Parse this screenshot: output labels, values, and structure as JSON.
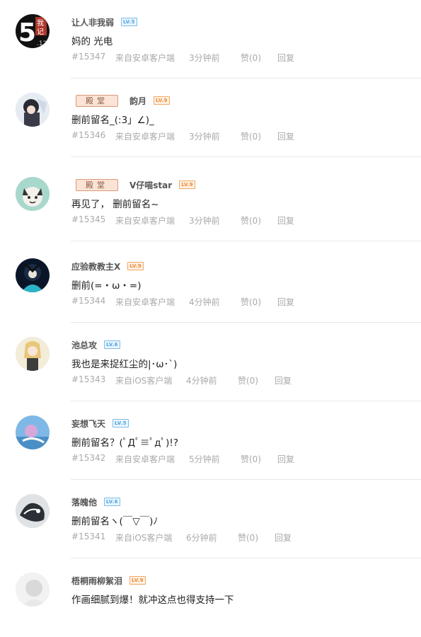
{
  "comments": [
    {
      "username": "让人非我弱",
      "level": "LV.5",
      "level_color": "#4aa3e0",
      "medal": "",
      "content": "妈的 光电",
      "number": "#15347",
      "source": "来自安卓客户端",
      "time": "3分钟前",
      "like": "赞(0)",
      "reply": "回复"
    },
    {
      "username": "韵月",
      "level": "LV.9",
      "level_color": "#f08a2e",
      "medal": "殿堂",
      "content": "删前留名_(:3」∠)_",
      "number": "#15346",
      "source": "来自安卓客户端",
      "time": "3分钟前",
      "like": "赞(0)",
      "reply": "回复"
    },
    {
      "username": "V仔喵star",
      "level": "LV.9",
      "level_color": "#f08a2e",
      "medal": "殿堂",
      "content": "再见了， 删前留名~",
      "number": "#15345",
      "source": "来自安卓客户端",
      "time": "3分钟前",
      "like": "赞(0)",
      "reply": "回复"
    },
    {
      "username": "应验教教主X",
      "level": "LV.9",
      "level_color": "#f08a2e",
      "medal": "",
      "content": "删前(=・ω・=)",
      "number": "#15344",
      "source": "来自安卓客户端",
      "time": "4分钟前",
      "like": "赞(0)",
      "reply": "回复"
    },
    {
      "username": "池总攻",
      "level": "LV.6",
      "level_color": "#4aa3e0",
      "medal": "",
      "content": "我也是来捉红尘的|･ω･`)",
      "number": "#15343",
      "source": "来自iOS客户端",
      "time": "4分钟前",
      "like": "赞(0)",
      "reply": "回复"
    },
    {
      "username": "妄想飞天",
      "level": "LV.5",
      "level_color": "#4aa3e0",
      "medal": "",
      "content": "删前留名？(ﾟДﾟ≡ﾟдﾟ)!?",
      "number": "#15342",
      "source": "来自安卓客户端",
      "time": "5分钟前",
      "like": "赞(0)",
      "reply": "回复"
    },
    {
      "username": "落魄他",
      "level": "LV.6",
      "level_color": "#4aa3e0",
      "medal": "",
      "content": "删前留名ヽ(￣▽￣)ﾉ",
      "number": "#15341",
      "source": "来自iOS客户端",
      "time": "6分钟前",
      "like": "赞(0)",
      "reply": "回复"
    },
    {
      "username": "梧桐雨柳絮泪",
      "level": "LV.9",
      "level_color": "#f08a2e",
      "medal": "",
      "content": "作画细腻到爆！就冲这点也得支持一下",
      "number": "",
      "source": "",
      "time": "",
      "like": "",
      "reply": ""
    }
  ]
}
